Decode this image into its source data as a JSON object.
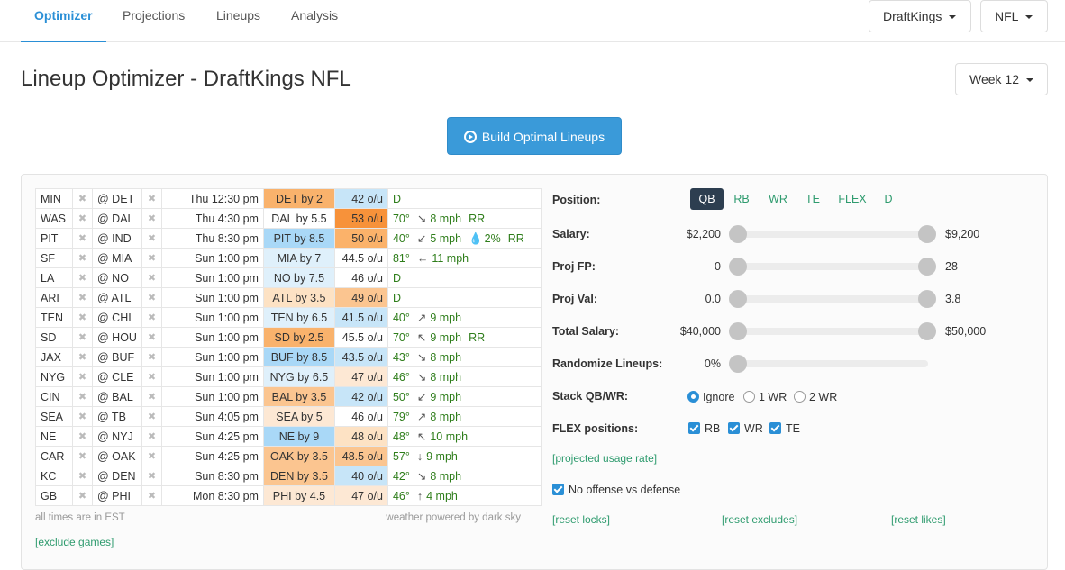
{
  "nav": {
    "tabs": [
      "Optimizer",
      "Projections",
      "Lineups",
      "Analysis"
    ],
    "site_select": "DraftKings",
    "sport_select": "NFL"
  },
  "page_title": "Lineup Optimizer - DraftKings NFL",
  "week_select": "Week 12",
  "build_button": "Build Optimal Lineups",
  "games": [
    {
      "team": "MIN",
      "opp": "@ DET",
      "time": "Thu 12:30 pm",
      "spread": "DET by 2",
      "ou": "42 o/u",
      "temp": "D",
      "wind": "",
      "rain": "",
      "rr": ""
    },
    {
      "team": "WAS",
      "opp": "@ DAL",
      "time": "Thu 4:30 pm",
      "spread": "DAL by 5.5",
      "ou": "53 o/u",
      "temp": "70°",
      "wind": "8 mph",
      "rain": "",
      "rr": "RR"
    },
    {
      "team": "PIT",
      "opp": "@ IND",
      "time": "Thu 8:30 pm",
      "spread": "PIT by 8.5",
      "ou": "50 o/u",
      "temp": "40°",
      "wind": "5 mph",
      "rain": "2%",
      "rr": "RR"
    },
    {
      "team": "SF",
      "opp": "@ MIA",
      "time": "Sun 1:00 pm",
      "spread": "MIA by 7",
      "ou": "44.5 o/u",
      "temp": "81°",
      "wind": "11 mph",
      "rain": "",
      "rr": ""
    },
    {
      "team": "LA",
      "opp": "@ NO",
      "time": "Sun 1:00 pm",
      "spread": "NO by 7.5",
      "ou": "46 o/u",
      "temp": "D",
      "wind": "",
      "rain": "",
      "rr": ""
    },
    {
      "team": "ARI",
      "opp": "@ ATL",
      "time": "Sun 1:00 pm",
      "spread": "ATL by 3.5",
      "ou": "49 o/u",
      "temp": "D",
      "wind": "",
      "rain": "",
      "rr": ""
    },
    {
      "team": "TEN",
      "opp": "@ CHI",
      "time": "Sun 1:00 pm",
      "spread": "TEN by 6.5",
      "ou": "41.5 o/u",
      "temp": "40°",
      "wind": "9 mph",
      "rain": "",
      "rr": ""
    },
    {
      "team": "SD",
      "opp": "@ HOU",
      "time": "Sun 1:00 pm",
      "spread": "SD by 2.5",
      "ou": "45.5 o/u",
      "temp": "70°",
      "wind": "9 mph",
      "rain": "",
      "rr": "RR"
    },
    {
      "team": "JAX",
      "opp": "@ BUF",
      "time": "Sun 1:00 pm",
      "spread": "BUF by 8.5",
      "ou": "43.5 o/u",
      "temp": "43°",
      "wind": "8 mph",
      "rain": "",
      "rr": ""
    },
    {
      "team": "NYG",
      "opp": "@ CLE",
      "time": "Sun 1:00 pm",
      "spread": "NYG by 6.5",
      "ou": "47 o/u",
      "temp": "46°",
      "wind": "8 mph",
      "rain": "",
      "rr": ""
    },
    {
      "team": "CIN",
      "opp": "@ BAL",
      "time": "Sun 1:00 pm",
      "spread": "BAL by 3.5",
      "ou": "42 o/u",
      "temp": "50°",
      "wind": "9 mph",
      "rain": "",
      "rr": ""
    },
    {
      "team": "SEA",
      "opp": "@ TB",
      "time": "Sun 4:05 pm",
      "spread": "SEA by 5",
      "ou": "46 o/u",
      "temp": "79°",
      "wind": "8 mph",
      "rain": "",
      "rr": ""
    },
    {
      "team": "NE",
      "opp": "@ NYJ",
      "time": "Sun 4:25 pm",
      "spread": "NE by 9",
      "ou": "48 o/u",
      "temp": "48°",
      "wind": "10 mph",
      "rain": "",
      "rr": ""
    },
    {
      "team": "CAR",
      "opp": "@ OAK",
      "time": "Sun 4:25 pm",
      "spread": "OAK by 3.5",
      "ou": "48.5 o/u",
      "temp": "57°",
      "wind": "9 mph",
      "rain": "",
      "rr": ""
    },
    {
      "team": "KC",
      "opp": "@ DEN",
      "time": "Sun 8:30 pm",
      "spread": "DEN by 3.5",
      "ou": "40 o/u",
      "temp": "42°",
      "wind": "8 mph",
      "rain": "",
      "rr": ""
    },
    {
      "team": "GB",
      "opp": "@ PHI",
      "time": "Mon 8:30 pm",
      "spread": "PHI by 4.5",
      "ou": "47 o/u",
      "temp": "46°",
      "wind": "4 mph",
      "rain": "",
      "rr": ""
    }
  ],
  "colors": {
    "spread": [
      "#f9b26c",
      "#ffffff",
      "#a9d8f7",
      "#dff0fb",
      "#dff0fb",
      "#fde2c4",
      "#dff0fb",
      "#f9b26c",
      "#a9d8f7",
      "#dff0fb",
      "#fbc590",
      "#fde8d4",
      "#a9d8f7",
      "#fbc590",
      "#fbc590",
      "#fde8d4"
    ],
    "ou": [
      "#c7e5f8",
      "#f7923a",
      "#fbb26a",
      "#ffffff",
      "#ffffff",
      "#fbc590",
      "#c7e5f8",
      "#ffffff",
      "#c7e5f8",
      "#fde8d4",
      "#c7e5f8",
      "#ffffff",
      "#fde2c4",
      "#fbc590",
      "#c7e5f8",
      "#fde8d4"
    ]
  },
  "wind_dirs": [
    "",
    "↘",
    "↙",
    "←",
    "",
    "",
    "↗",
    "↖",
    "↘",
    "↘",
    "↙",
    "↗",
    "↖",
    "↓",
    "↘",
    "↑"
  ],
  "table_notes": {
    "left": "all times are in EST",
    "right": "weather powered by dark sky"
  },
  "exclude_games_link": "[exclude games]",
  "settings": {
    "position_label": "Position:",
    "positions": [
      "QB",
      "RB",
      "WR",
      "TE",
      "FLEX",
      "D"
    ],
    "salary": {
      "label": "Salary:",
      "min": "$2,200",
      "max": "$9,200"
    },
    "proj_fp": {
      "label": "Proj FP:",
      "min": "0",
      "max": "28"
    },
    "proj_val": {
      "label": "Proj Val:",
      "min": "0.0",
      "max": "3.8"
    },
    "total_salary": {
      "label": "Total Salary:",
      "min": "$40,000",
      "max": "$50,000"
    },
    "randomize": {
      "label": "Randomize Lineups:",
      "value": "0%"
    },
    "stack": {
      "label": "Stack QB/WR:",
      "options": [
        "Ignore",
        "1 WR",
        "2 WR"
      ],
      "selected": "Ignore"
    },
    "flex": {
      "label": "FLEX positions:",
      "options": [
        "RB",
        "WR",
        "TE"
      ]
    },
    "usage_link": "[projected usage rate]",
    "no_offense_vs_defense": "No offense vs defense",
    "reset_locks": "[reset locks]",
    "reset_excludes": "[reset excludes]",
    "reset_likes": "[reset likes]"
  }
}
